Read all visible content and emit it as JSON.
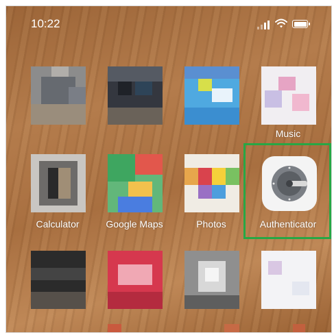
{
  "status_bar": {
    "time": "10:22",
    "icons": [
      "cellular-signal-icon",
      "wifi-icon",
      "battery-icon"
    ]
  },
  "home_screen": {
    "rows": [
      [
        {
          "name": "app-1",
          "label": ""
        },
        {
          "name": "app-2",
          "label": ""
        },
        {
          "name": "app-3",
          "label": ""
        },
        {
          "name": "music",
          "label": "Music"
        }
      ],
      [
        {
          "name": "calculator",
          "label": "Calculator"
        },
        {
          "name": "google-maps",
          "label": "Google Maps"
        },
        {
          "name": "photos",
          "label": "Photos"
        },
        {
          "name": "authenticator",
          "label": "Authenticator",
          "highlighted": true
        }
      ],
      [
        {
          "name": "app-9",
          "label": ""
        },
        {
          "name": "app-10",
          "label": ""
        },
        {
          "name": "app-11",
          "label": ""
        },
        {
          "name": "app-12",
          "label": ""
        }
      ]
    ]
  },
  "colors": {
    "highlight": "#27a745",
    "wallpaper": "#b47c4c",
    "label_text": "#ffffff"
  }
}
